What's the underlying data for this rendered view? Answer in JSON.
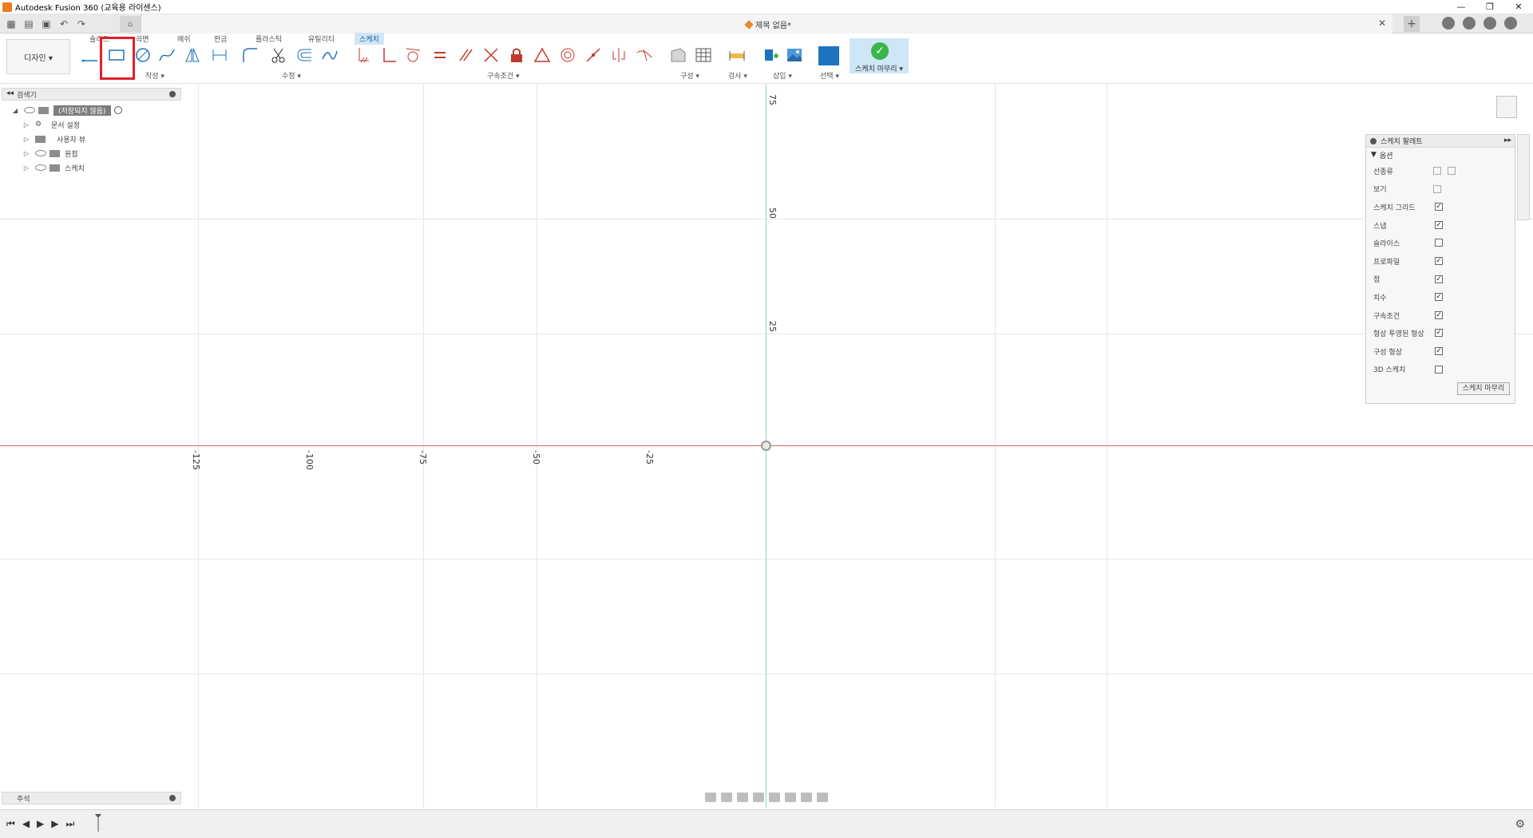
{
  "app": {
    "title": "Autodesk Fusion 360 (교육용 라이센스)",
    "document_title": "제목 없음*",
    "window_controls": [
      "—",
      "❐",
      "✕"
    ]
  },
  "ribbon": {
    "workspace_label": "디자인 ▾",
    "tabs": [
      "솔리드",
      "곡면",
      "메쉬",
      "판금",
      "플라스틱",
      "유틸리티",
      "스케치"
    ],
    "active_tab": "스케치",
    "groups": {
      "create": "작성 ▾",
      "modify": "수정 ▾",
      "constraints": "구속조건 ▾",
      "construct": "구성 ▾",
      "inspect": "검사 ▾",
      "insert": "삽입 ▾",
      "select": "선택 ▾",
      "finish": "스케치 마무리 ▾"
    }
  },
  "browser": {
    "title": "검색기",
    "root": "(저장되지 않음)",
    "items": [
      "문서 설정",
      "사용자 뷰",
      "원점",
      "스케치"
    ]
  },
  "canvas": {
    "x_ticks": [
      "-125",
      "-100",
      "-75",
      "-50",
      "-25"
    ],
    "y_ticks": [
      "75",
      "50",
      "25"
    ]
  },
  "palette": {
    "title": "스케치 팔레트",
    "section": "옵션",
    "rows": [
      {
        "label": "선종류",
        "type": "icons"
      },
      {
        "label": "보기",
        "type": "icon"
      },
      {
        "label": "스케치 그리드",
        "checked": true
      },
      {
        "label": "스냅",
        "checked": true
      },
      {
        "label": "슬라이스",
        "checked": false
      },
      {
        "label": "프로파일",
        "checked": true
      },
      {
        "label": "점",
        "checked": true
      },
      {
        "label": "치수",
        "checked": true
      },
      {
        "label": "구속조건",
        "checked": true
      },
      {
        "label": "형상 투영된 형상",
        "checked": true
      },
      {
        "label": "구성 형상",
        "checked": true
      },
      {
        "label": "3D 스케치",
        "checked": false
      }
    ],
    "finish_label": "스케치 마무리"
  },
  "comments": {
    "title": "주석"
  },
  "colors": {
    "accent": "#1e73be",
    "x_axis": "#e06666",
    "y_axis": "#8fd0c8",
    "highlight": "#e0202a",
    "finish": "#3ab54a"
  }
}
